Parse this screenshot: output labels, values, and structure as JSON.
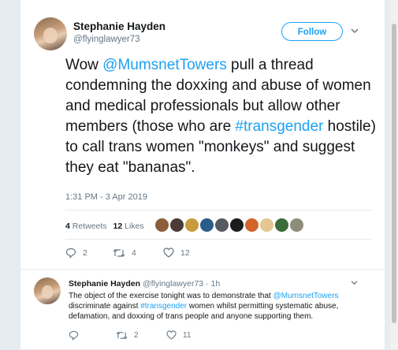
{
  "tweet": {
    "name": "Stephanie Hayden",
    "handle": "@flyinglawyer73",
    "follow_label": "Follow",
    "text_1": "Wow ",
    "mention": "@MumsnetTowers",
    "text_2": " pull a thread condemning the doxxing and abuse of women and medical professionals but allow other members (those who are ",
    "hashtag": "#transgender",
    "text_3": " hostile) to call trans women \"monkeys\" and suggest they eat \"bananas\".",
    "timestamp": "1:31 PM - 3 Apr 2019",
    "retweets_count": "4",
    "retweets_label": "Retweets",
    "likes_count": "12",
    "likes_label": "Likes",
    "reply_count": "2",
    "retweet_action_count": "4",
    "like_action_count": "12"
  },
  "reply": {
    "name": "Stephanie Hayden",
    "handle": "@flyinglawyer73 · 1h",
    "text_1": "The object of the exercise tonight was to demonstrate that ",
    "mention": "@MumsnetTowers",
    "text_2": " discriminate against ",
    "hashtag": "#transgender",
    "text_3": " women whilst permitting systematic abuse, defamation, and doxxing of trans people and anyone supporting them.",
    "retweet_count": "2",
    "like_count": "11"
  },
  "colors": {
    "accent": "#1da1f2",
    "muted": "#657786",
    "text": "#14171a",
    "divider": "#e6ecf0"
  },
  "icons": [
    "reply-icon",
    "retweet-icon",
    "heart-icon",
    "chevron-down-icon"
  ]
}
